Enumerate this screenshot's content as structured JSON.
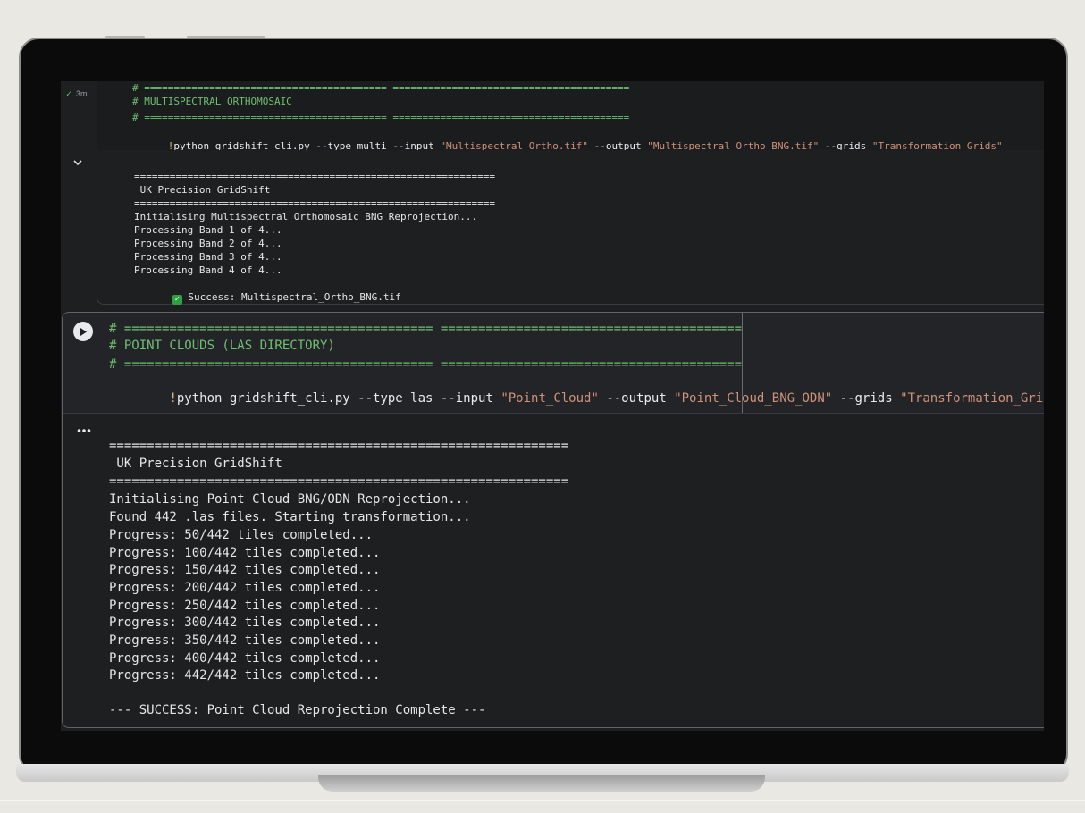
{
  "cell1": {
    "exec_time": "3m",
    "code": {
      "sep": "# ========================================= ========================================",
      "title": "# MULTISPECTRAL ORTHOMOSAIC",
      "cmd_bang": "!",
      "cmd_a": "python gridshift_cli.py --type multi --input ",
      "cmd_input": "\"Multispectral_Ortho.tif\"",
      "cmd_b": " --output ",
      "cmd_output": "\"Multispectral_Ortho_BNG.tif\"",
      "cmd_c": " --grids ",
      "cmd_grids": "\"Transformation_Grids\""
    },
    "output": {
      "sep": "=============================================================",
      "header": " UK Precision GridShift",
      "lines": [
        "Initialising Multispectral Orthomosaic BNG Reprojection...",
        "Processing Band 1 of 4...",
        "Processing Band 2 of 4...",
        "Processing Band 3 of 4...",
        "Processing Band 4 of 4..."
      ],
      "success": " Success: Multispectral_Ortho_BNG.tif"
    }
  },
  "cell2": {
    "code": {
      "sep": "# ========================================= ========================================",
      "title": "# POINT CLOUDS (LAS DIRECTORY)",
      "cmd_bang": "!",
      "cmd_a": "python gridshift_cli.py --type las --input ",
      "cmd_input": "\"Point_Cloud\"",
      "cmd_b": " --output ",
      "cmd_output": "\"Point_Cloud_BNG_ODN\"",
      "cmd_c": " --grids ",
      "cmd_grids": "\"Transformation_Grids\""
    },
    "output": {
      "sep": "=============================================================",
      "header": " UK Precision GridShift",
      "lines": [
        "Initialising Point Cloud BNG/ODN Reprojection...",
        "Found 442 .las files. Starting transformation...",
        "Progress: 50/442 tiles completed...",
        "Progress: 100/442 tiles completed...",
        "Progress: 150/442 tiles completed...",
        "Progress: 200/442 tiles completed...",
        "Progress: 250/442 tiles completed...",
        "Progress: 300/442 tiles completed...",
        "Progress: 350/442 tiles completed...",
        "Progress: 400/442 tiles completed...",
        "Progress: 442/442 tiles completed..."
      ],
      "final": "--- SUCCESS: Point Cloud Reprojection Complete ---"
    }
  },
  "icons": {
    "run": "play-icon",
    "collapse": "chevron-down-icon",
    "more": "more-horizontal-icon",
    "check": "check-icon",
    "success": "check-box-icon"
  },
  "colors": {
    "comment": "#6fbf73",
    "string": "#ce9178",
    "text": "#e8eaed",
    "background": "#1e1f21"
  }
}
